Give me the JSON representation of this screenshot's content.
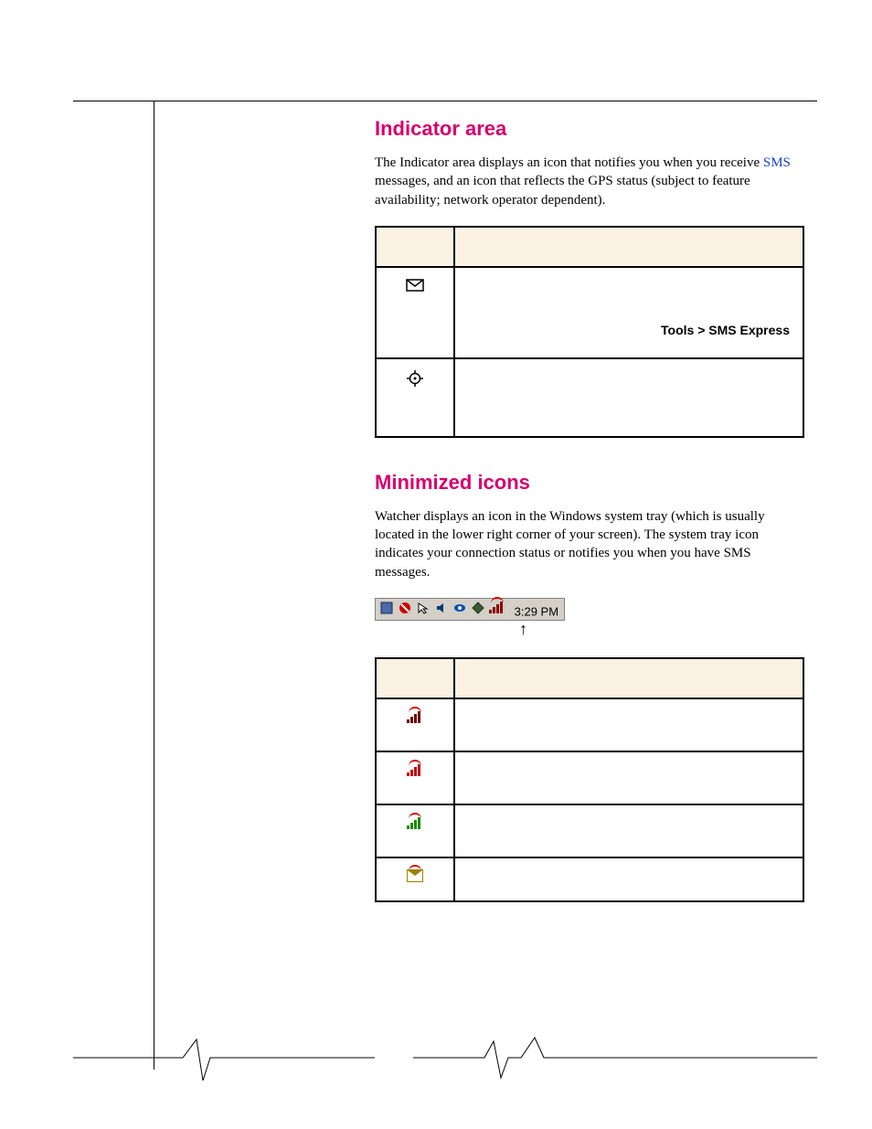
{
  "section1": {
    "heading": "Indicator area",
    "para_before_link": "The Indicator area displays an icon that notifies you when you receive ",
    "link_text": "SMS",
    "para_after_link": " messages, and an icon that reflects the GPS status (subject to feature availability; network operator dependent).",
    "table": {
      "header_icon": "",
      "header_meaning": "",
      "row1_path": "Tools > SMS Express"
    }
  },
  "section2": {
    "heading": "Minimized icons",
    "para": "Watcher displays an icon in the Windows system tray (which is usually located in the lower right corner of your screen). The system tray icon indicates your connection status or notifies you when you have SMS messages.",
    "tray_time": "3:29 PM",
    "table": {
      "header_icon": "",
      "header_meaning": ""
    }
  }
}
